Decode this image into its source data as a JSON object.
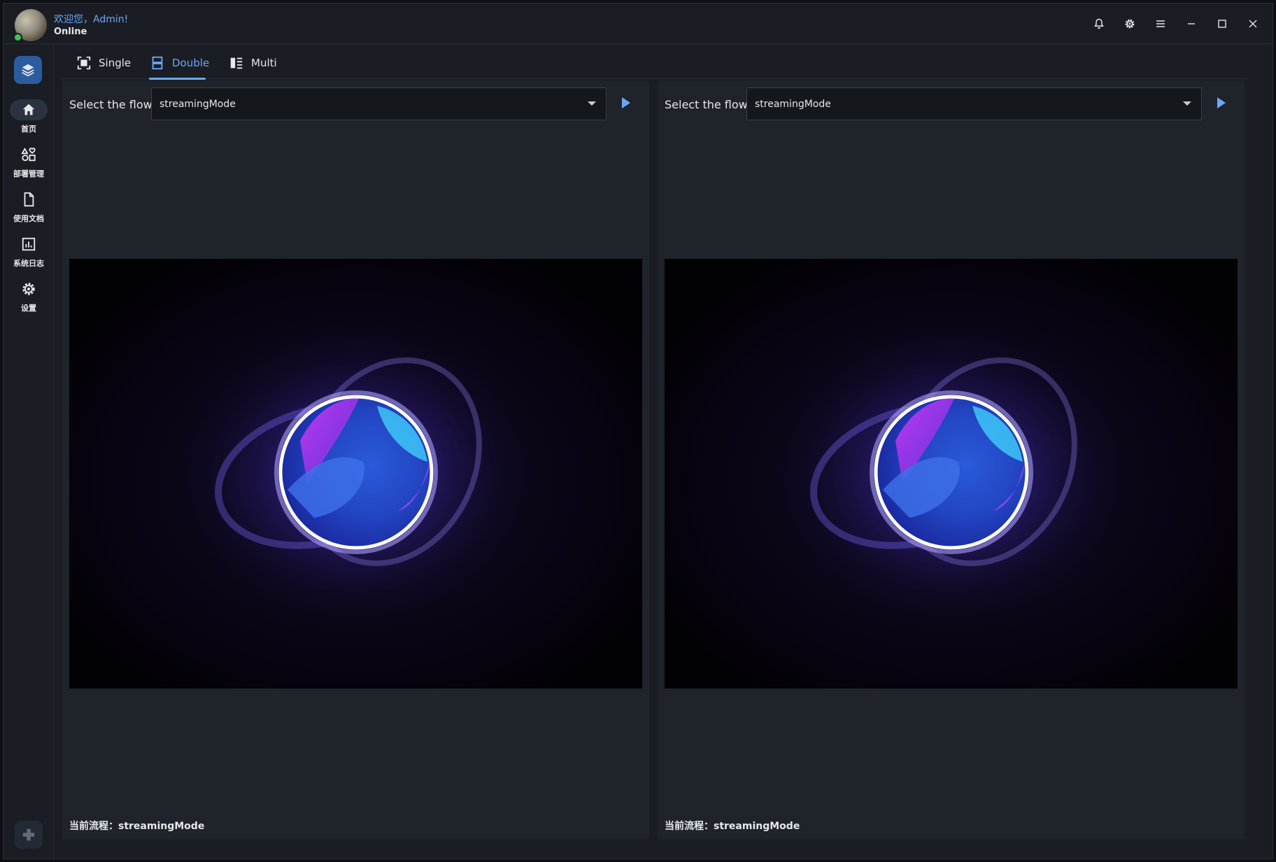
{
  "header": {
    "welcome": "欢迎您，Admin!",
    "status": "Online",
    "icons": [
      "bell-icon",
      "settings-icon",
      "menu-icon",
      "minimize-icon",
      "maximize-icon",
      "close-icon"
    ]
  },
  "sidebar": {
    "items": [
      {
        "label": "首页",
        "icon": "home-icon",
        "active": true
      },
      {
        "label": "部署管理",
        "icon": "apps-icon",
        "active": false
      },
      {
        "label": "使用文档",
        "icon": "document-icon",
        "active": false
      },
      {
        "label": "系统日志",
        "icon": "chart-icon",
        "active": false
      },
      {
        "label": "设置",
        "icon": "settings-icon",
        "active": false
      }
    ]
  },
  "tabs": [
    {
      "label": "Single",
      "active": false
    },
    {
      "label": "Double",
      "active": true
    },
    {
      "label": "Multi",
      "active": false
    }
  ],
  "panels": [
    {
      "flow_label": "Select the flow",
      "selected": "streamingMode",
      "current": "当前流程：streamingMode"
    },
    {
      "flow_label": "Select the flow",
      "selected": "streamingMode",
      "current": "当前流程：streamingMode"
    }
  ],
  "colors": {
    "accent": "#6aa8ff",
    "background": "#1a1d23",
    "online": "#3cc454"
  }
}
